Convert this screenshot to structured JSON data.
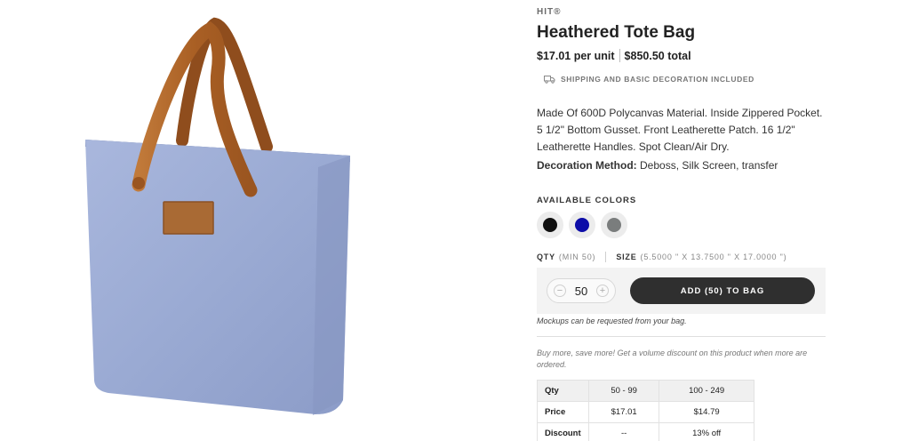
{
  "product": {
    "brand": "HIT®",
    "title": "Heathered Tote Bag",
    "price_per_unit": "$17.01 per unit",
    "price_total": "$850.50 total",
    "shipping_note": "SHIPPING AND BASIC DECORATION INCLUDED",
    "description": "Made Of 600D Polycanvas Material. Inside Zippered Pocket. 5 1/2\" Bottom Gusset. Front Leatherette Patch. 16 1/2\" Leatherette Handles. Spot Clean/Air Dry.",
    "decoration_label": "Decoration Method:",
    "decoration_value": "Deboss, Silk Screen, transfer"
  },
  "colors": {
    "label": "AVAILABLE COLORS",
    "options": [
      {
        "name": "black",
        "hex": "#111111"
      },
      {
        "name": "blue",
        "hex": "#0d0da8"
      },
      {
        "name": "gray",
        "hex": "#7a7d7d"
      }
    ]
  },
  "order": {
    "qty_label": "QTY",
    "qty_min": "(MIN 50)",
    "size_label": "SIZE",
    "size_value": "(5.5000 \" X 13.7500 \" X 17.0000 \")",
    "quantity": "50",
    "minus": "−",
    "plus": "+",
    "add_button": "ADD (50) TO BAG",
    "mockups_note": "Mockups can be requested from your bag.",
    "volume_note": "Buy more, save more! Get a volume discount on this product when more are ordered."
  },
  "pricing_table": {
    "rows": [
      [
        "Qty",
        "50 - 99",
        "100 - 249"
      ],
      [
        "Price",
        "$17.01",
        "$14.79"
      ],
      [
        "Discount",
        "--",
        "13% off"
      ]
    ]
  },
  "theme": {
    "bag_color": "#9aaad3",
    "strap_color": "#b26a2e",
    "button_color": "#2f2f2f"
  }
}
